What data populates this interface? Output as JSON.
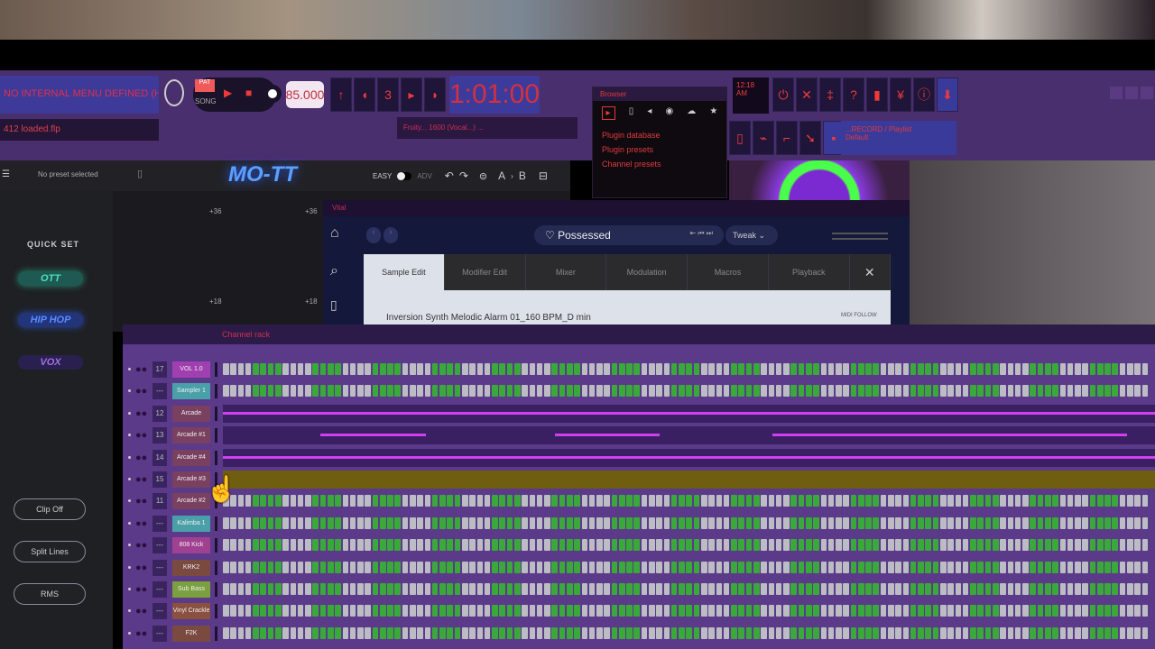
{
  "toolbar": {
    "hint": "NO INTERNAL MENU DEFINED (HINT BAR)",
    "status": "412 loaded.flp",
    "pat_label": "PAT",
    "song_label": "SONG",
    "bpm": "85.000",
    "time": "1:01:00",
    "clock": "12:18 AM",
    "hint_panel": "Fruity... 1600 (Vocal...) ... ",
    "right_panel_line1": "...RECORD / Playlist",
    "right_panel_line2": "Default"
  },
  "browser": {
    "title": "Browser",
    "items": [
      "Plugin database",
      "Plugin presets",
      "Channel presets"
    ]
  },
  "ott": {
    "preset": "No preset selected",
    "logo": "MO-TT",
    "mode_easy": "EASY",
    "mode_adv": "ADV",
    "undo": "↶",
    "redo": "↷",
    "compare_a": "A",
    "compare_b": "B",
    "quick_set_label": "QUICK SET",
    "quick_sets": [
      "OTT",
      "HIP HOP",
      "VOX"
    ],
    "buttons": [
      "Clip Off",
      "Split Lines",
      "RMS"
    ],
    "db_labels": [
      "+36",
      "+36",
      "+18",
      "+18"
    ]
  },
  "vital": {
    "window_title": "Vital",
    "preset": "Possessed",
    "tweak": "Tweak",
    "tabs": [
      "Sample Edit",
      "Modifier Edit",
      "Mixer",
      "Modulation",
      "Macros",
      "Playback"
    ],
    "sample_name": "Inversion Synth Melodic Alarm 01_160 BPM_D min",
    "follow": "MIDI FOLLOW"
  },
  "rack": {
    "title": "Channel rack",
    "channels": [
      {
        "num": "17",
        "name": "VOL 1.0",
        "color": "#a040b0",
        "type": "steps"
      },
      {
        "num": "---",
        "name": "Sampler 1",
        "color": "#4aa0a8",
        "type": "steps"
      },
      {
        "num": "12",
        "name": "Arcade",
        "color": "#7a4060",
        "type": "line"
      },
      {
        "num": "13",
        "name": "Arcade #1",
        "color": "#7a4060",
        "type": "segments"
      },
      {
        "num": "14",
        "name": "Arcade #4",
        "color": "#7a4060",
        "type": "line"
      },
      {
        "num": "15",
        "name": "Arcade #3",
        "color": "#7a4060",
        "type": "olive"
      },
      {
        "num": "11",
        "name": "Arcade #2",
        "color": "#7a4060",
        "type": "steps"
      },
      {
        "num": "---",
        "name": "Kalimba 1",
        "color": "#4aa0a8",
        "type": "steps"
      },
      {
        "num": "---",
        "name": "808 Kick",
        "color": "#a04090",
        "type": "steps"
      },
      {
        "num": "---",
        "name": "KRK2",
        "color": "#7a4a40",
        "type": "steps"
      },
      {
        "num": "---",
        "name": "Sub Bass",
        "color": "#7aa040",
        "type": "steps"
      },
      {
        "num": "---",
        "name": "Vinyl Crackle",
        "color": "#8a5040",
        "type": "steps"
      },
      {
        "num": "---",
        "name": "F2K",
        "color": "#7a4a40",
        "type": "steps"
      }
    ]
  },
  "colors": {
    "accent": "#d040f0",
    "step_on": "#3aa83a",
    "step_off": "#bcbcc4"
  }
}
